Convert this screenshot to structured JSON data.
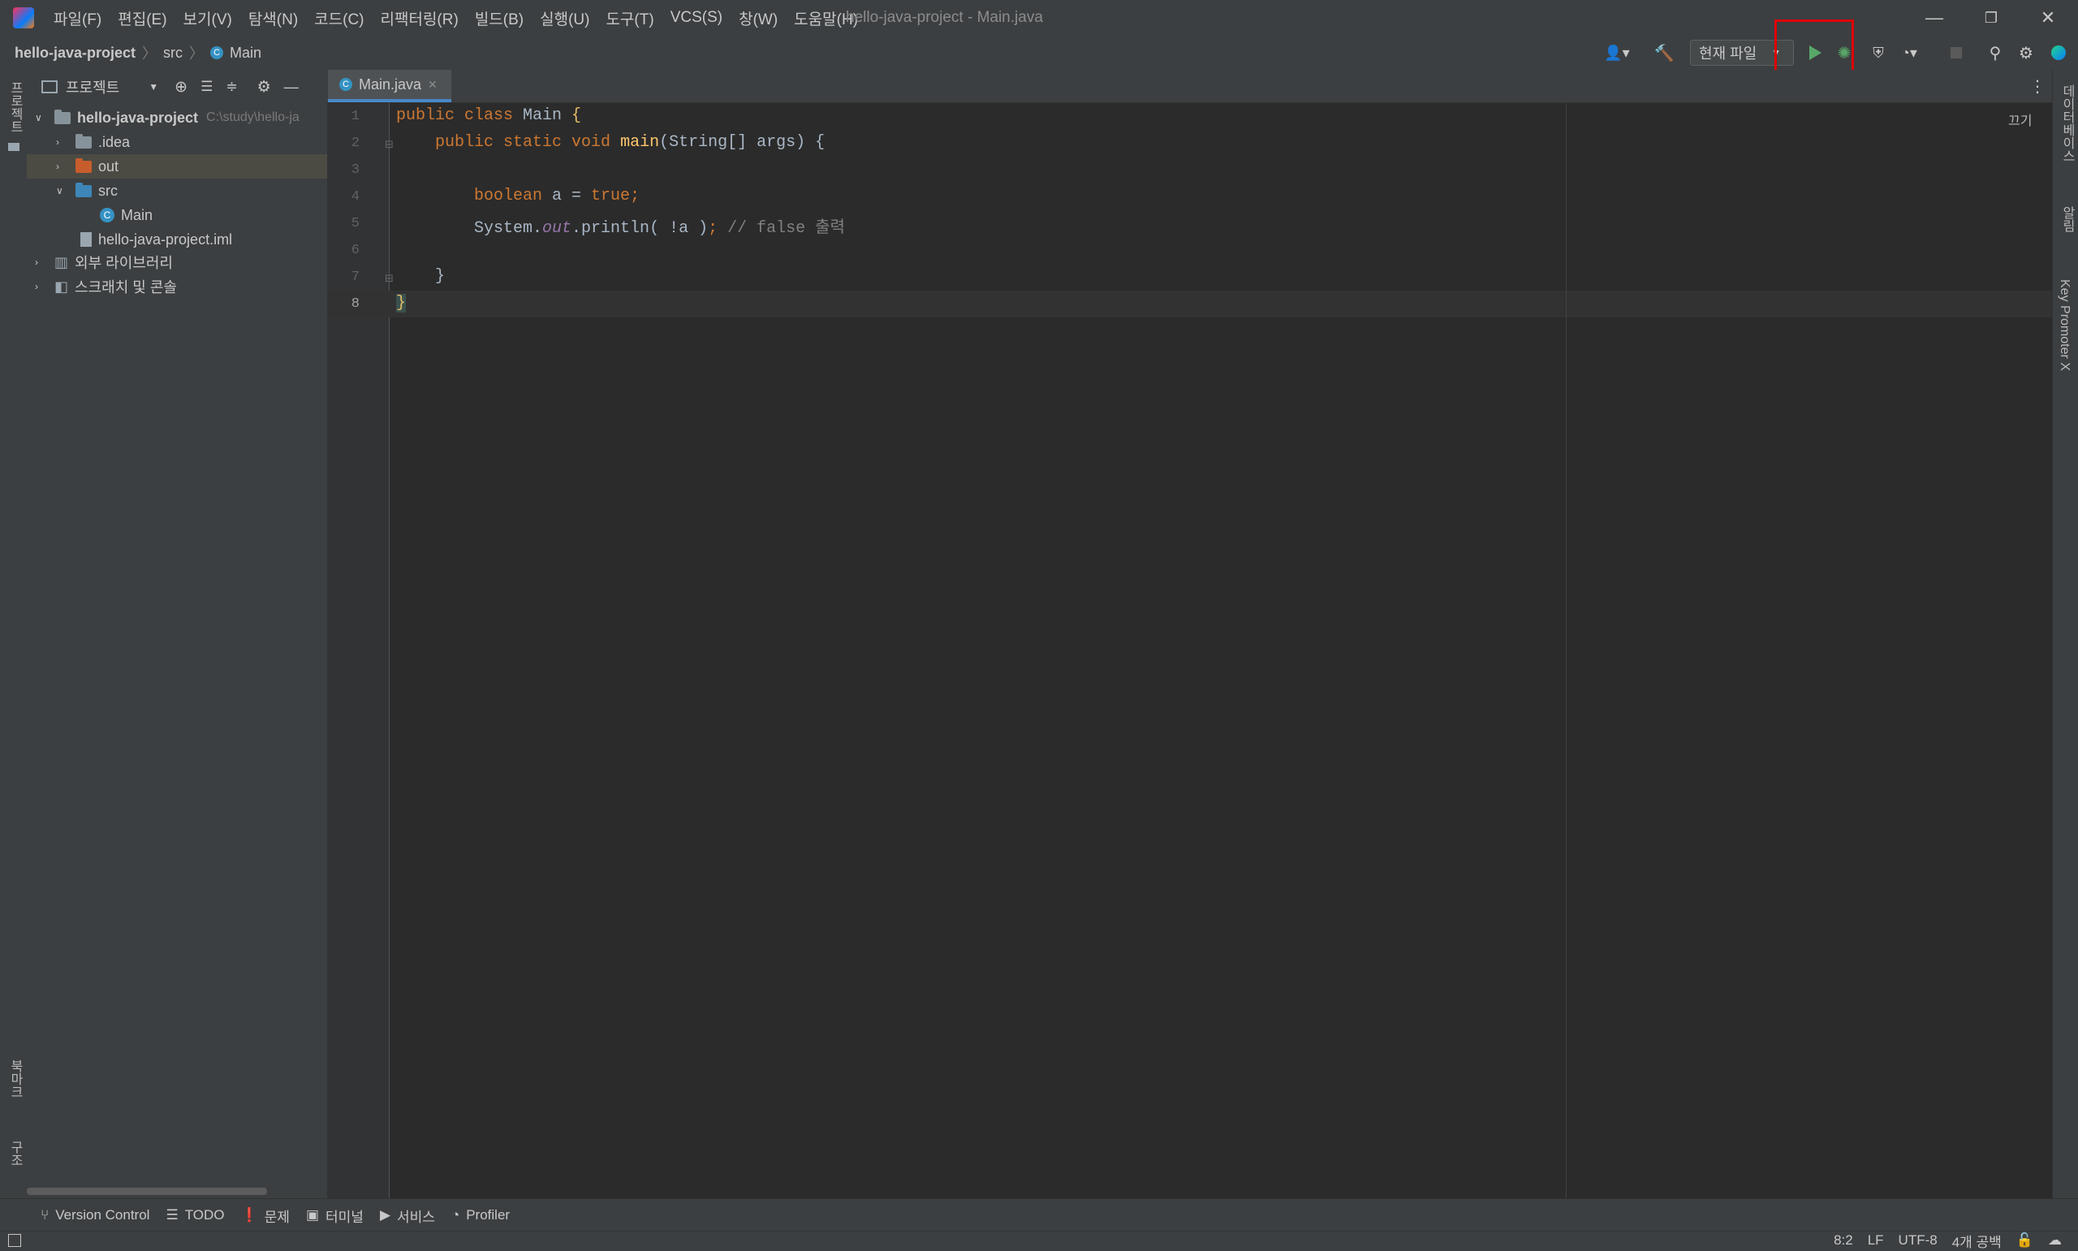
{
  "window": {
    "title": "hello-java-project - Main.java",
    "menu": [
      "파일(F)",
      "편집(E)",
      "보기(V)",
      "탐색(N)",
      "코드(C)",
      "리팩터링(R)",
      "빌드(B)",
      "실행(U)",
      "도구(T)",
      "VCS(S)",
      "창(W)",
      "도움말(H)"
    ]
  },
  "breadcrumb": {
    "project": "hello-java-project",
    "folder": "src",
    "file": "Main"
  },
  "toolbar": {
    "run_config": "현재 파일"
  },
  "left_strip": {
    "project_label": "프로젝트",
    "bookmarks_label": "북마크",
    "structure_label": "구조"
  },
  "right_strip": {
    "database_label": "데이터베이스",
    "notifications_label": "알림",
    "keypromoter_label": "Key Promoter X"
  },
  "project_panel": {
    "title": "프로젝트",
    "tree": [
      {
        "label": "hello-java-project",
        "path": "C:\\study\\hello-ja",
        "indent": 0,
        "expanded": true,
        "kind": "project"
      },
      {
        "label": ".idea",
        "indent": 1,
        "expanded": false,
        "kind": "folder"
      },
      {
        "label": "out",
        "indent": 1,
        "expanded": false,
        "kind": "folder-out",
        "selected": true
      },
      {
        "label": "src",
        "indent": 1,
        "expanded": true,
        "kind": "folder-src"
      },
      {
        "label": "Main",
        "indent": 2,
        "kind": "class"
      },
      {
        "label": "hello-java-project.iml",
        "indent": 1,
        "kind": "file"
      },
      {
        "label": "외부 라이브러리",
        "indent": 0,
        "expanded": false,
        "kind": "library"
      },
      {
        "label": "스크래치 및 콘솔",
        "indent": 0,
        "expanded": false,
        "kind": "scratch"
      }
    ]
  },
  "editor": {
    "tab": "Main.java",
    "reader_mode": "끄기",
    "line_numbers": [
      "1",
      "2",
      "3",
      "4",
      "5",
      "6",
      "7",
      "8"
    ]
  },
  "bottom_tools": [
    "Version Control",
    "TODO",
    "문제",
    "터미널",
    "서비스",
    "Profiler"
  ],
  "status": {
    "position": "8:2",
    "line_sep": "LF",
    "encoding": "UTF-8",
    "indent": "4개 공백"
  }
}
